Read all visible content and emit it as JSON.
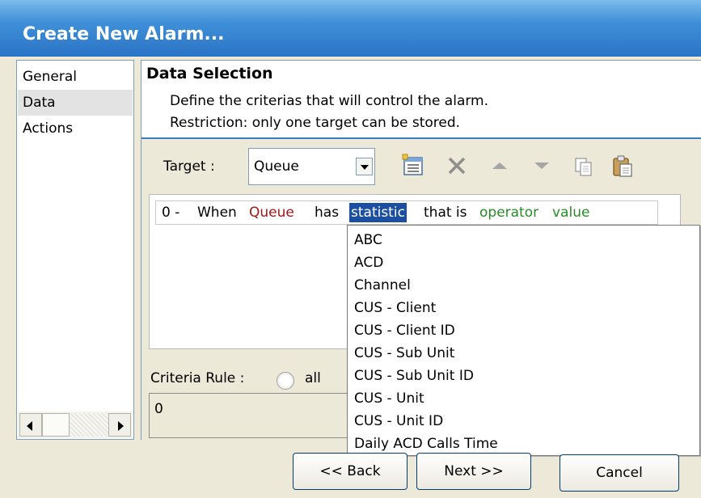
{
  "window": {
    "title": "Create New Alarm..."
  },
  "nav": {
    "items": [
      "General",
      "Data",
      "Actions"
    ],
    "selected": "Data"
  },
  "header": {
    "title": "Data Selection",
    "line1": "Define the criterias that will control the alarm.",
    "line2": "Restriction: only one target can be stored."
  },
  "target": {
    "label": "Target :",
    "value": "Queue"
  },
  "criteria": {
    "index": "0 -",
    "when": "When",
    "target": "Queue",
    "has": "has",
    "statistic": "statistic",
    "that_is": "that is",
    "operator": "operator",
    "value": "value"
  },
  "statistic_options": [
    "ABC",
    "ACD",
    "Channel",
    "CUS - Client",
    "CUS - Client ID",
    "CUS - Sub Unit",
    "CUS - Sub Unit ID",
    "CUS - Unit",
    "CUS - Unit ID",
    "Daily ACD Calls Time"
  ],
  "criteria_rule": {
    "label": "Criteria Rule :",
    "option_all": "all",
    "expression": "0"
  },
  "buttons": {
    "back": "<< Back",
    "next": "Next >>",
    "cancel": "Cancel"
  },
  "colors": {
    "target_token": "#a01818",
    "operator_token": "#2a8a2a",
    "highlight": "#1c4f9f"
  },
  "toolbar_icons": [
    "properties-icon",
    "delete-icon",
    "move-up-icon",
    "move-down-icon",
    "copy-icon",
    "paste-icon"
  ]
}
